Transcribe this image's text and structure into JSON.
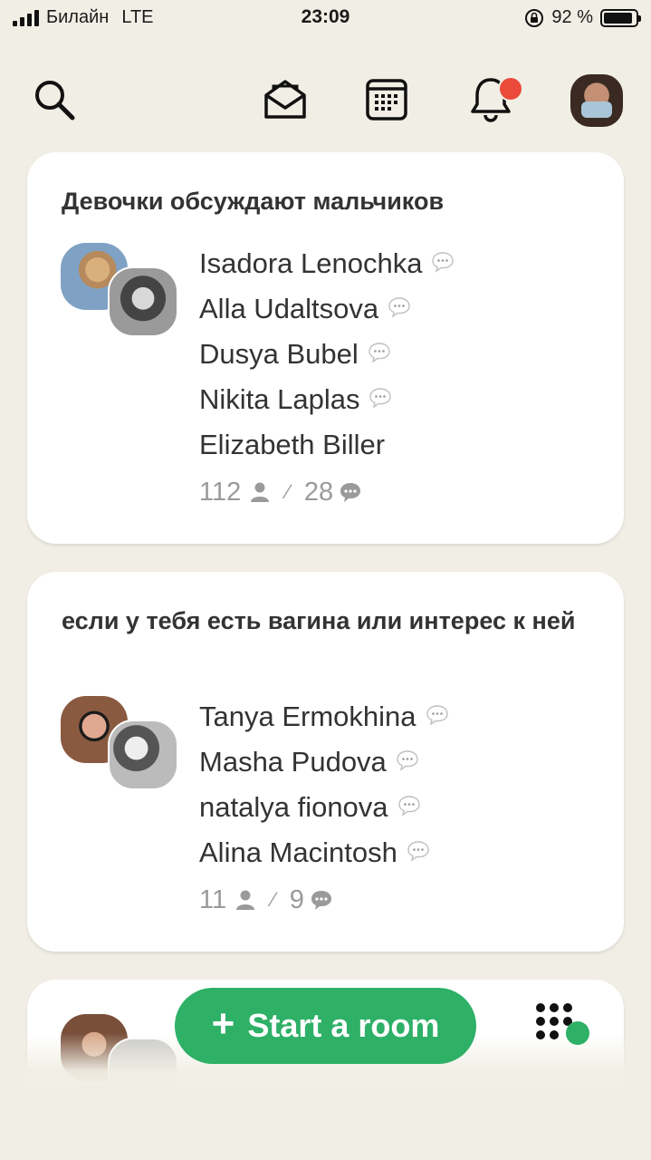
{
  "status_bar": {
    "carrier": "Билайн",
    "network": "LTE",
    "time": "23:09",
    "battery": "92 %",
    "battery_level": 0.92
  },
  "nav": {
    "icons": [
      "search-icon",
      "invite-envelope-icon",
      "calendar-icon",
      "bell-icon",
      "profile-avatar"
    ],
    "has_notification": true
  },
  "rooms": [
    {
      "title": "Девочки обсуждают мальчиков",
      "speakers": [
        {
          "name": "Isadora Lenochka",
          "speaking": true
        },
        {
          "name": "Alla Udaltsova",
          "speaking": true
        },
        {
          "name": "Dusya Bubel",
          "speaking": true
        },
        {
          "name": "Nikita Laplas",
          "speaking": true
        },
        {
          "name": "Elizabeth Biller",
          "speaking": false
        }
      ],
      "listeners": "112",
      "chat_count": "28"
    },
    {
      "title": "если у тебя есть вагина или интерес к ней",
      "speakers": [
        {
          "name": "Tanya Ermokhina",
          "speaking": true
        },
        {
          "name": "Masha Pudova",
          "speaking": true
        },
        {
          "name": "natalya fionova",
          "speaking": true
        },
        {
          "name": "Alina Macintosh",
          "speaking": true
        }
      ],
      "listeners": "11",
      "chat_count": "9"
    }
  ],
  "actions": {
    "start_room": "Start a room"
  },
  "colors": {
    "background": "#f1efe5",
    "accent_green": "#2eb067",
    "notification_red": "#eb4a3a",
    "muted_text": "#9a9a9a"
  }
}
